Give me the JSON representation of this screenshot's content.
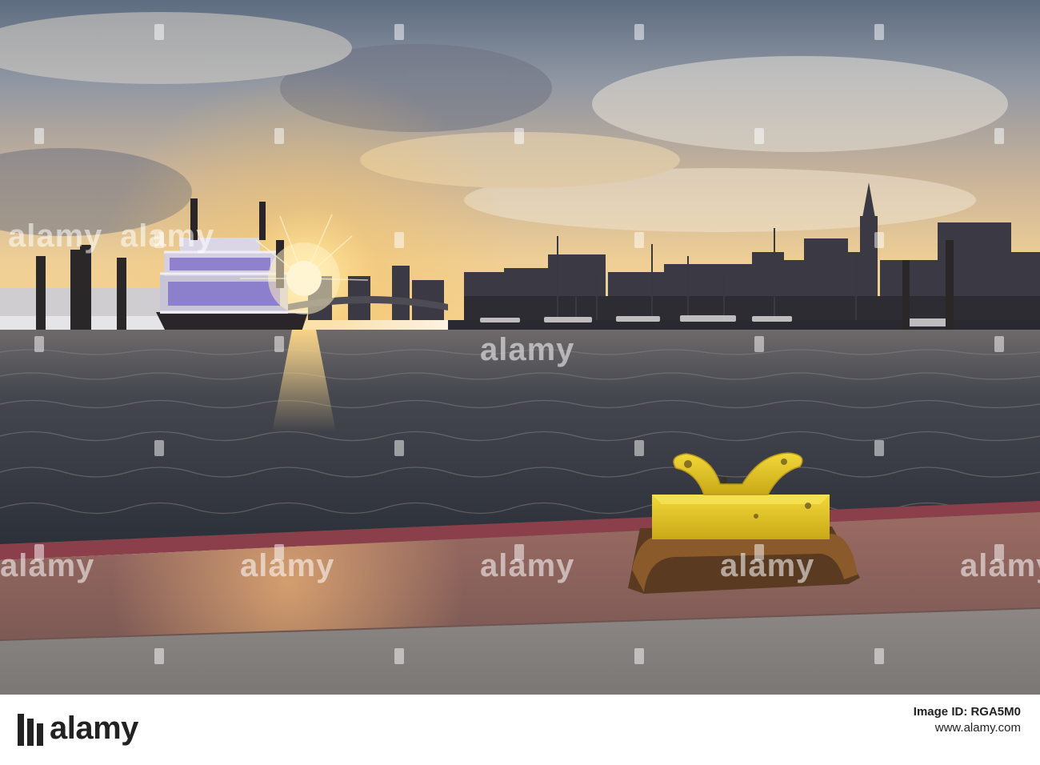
{
  "watermark": {
    "text": "alamy",
    "color": "#ffffff"
  },
  "footer": {
    "logo_text": "alamy",
    "image_id_label": "Image ID: RGA5M0",
    "website": "www.alamy.com",
    "background": "#ffffff",
    "text_color": "#222222"
  },
  "scene": {
    "description_icon": "harbour-sunset-photo",
    "sky_colors": [
      "#f7d9a0",
      "#c9a989",
      "#8a8a99",
      "#55657a"
    ],
    "water_color": "#3a3d46",
    "bollard_color": "#e3c52a",
    "quay_color": "#8a5e57"
  }
}
